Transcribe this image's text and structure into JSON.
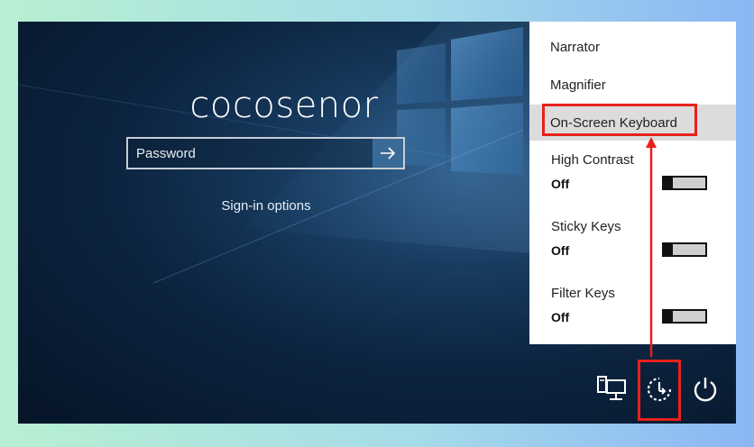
{
  "login": {
    "username": "cocosenor",
    "password_placeholder": "Password",
    "signin_options": "Sign-in options"
  },
  "ease_of_access_menu": {
    "items": [
      {
        "label": "Narrator"
      },
      {
        "label": "Magnifier"
      },
      {
        "label": "On-Screen Keyboard",
        "highlighted": true
      }
    ],
    "toggles": [
      {
        "label": "High Contrast",
        "state": "Off"
      },
      {
        "label": "Sticky Keys",
        "state": "Off"
      },
      {
        "label": "Filter Keys",
        "state": "Off"
      }
    ]
  },
  "bottom_icons": [
    "network-icon",
    "ease-of-access-icon",
    "power-icon"
  ],
  "colors": {
    "annotation_red": "#e8211c",
    "menu_background": "#ffffff",
    "selected_item": "#dcdcdc",
    "submit_button": "#3a6a96"
  }
}
